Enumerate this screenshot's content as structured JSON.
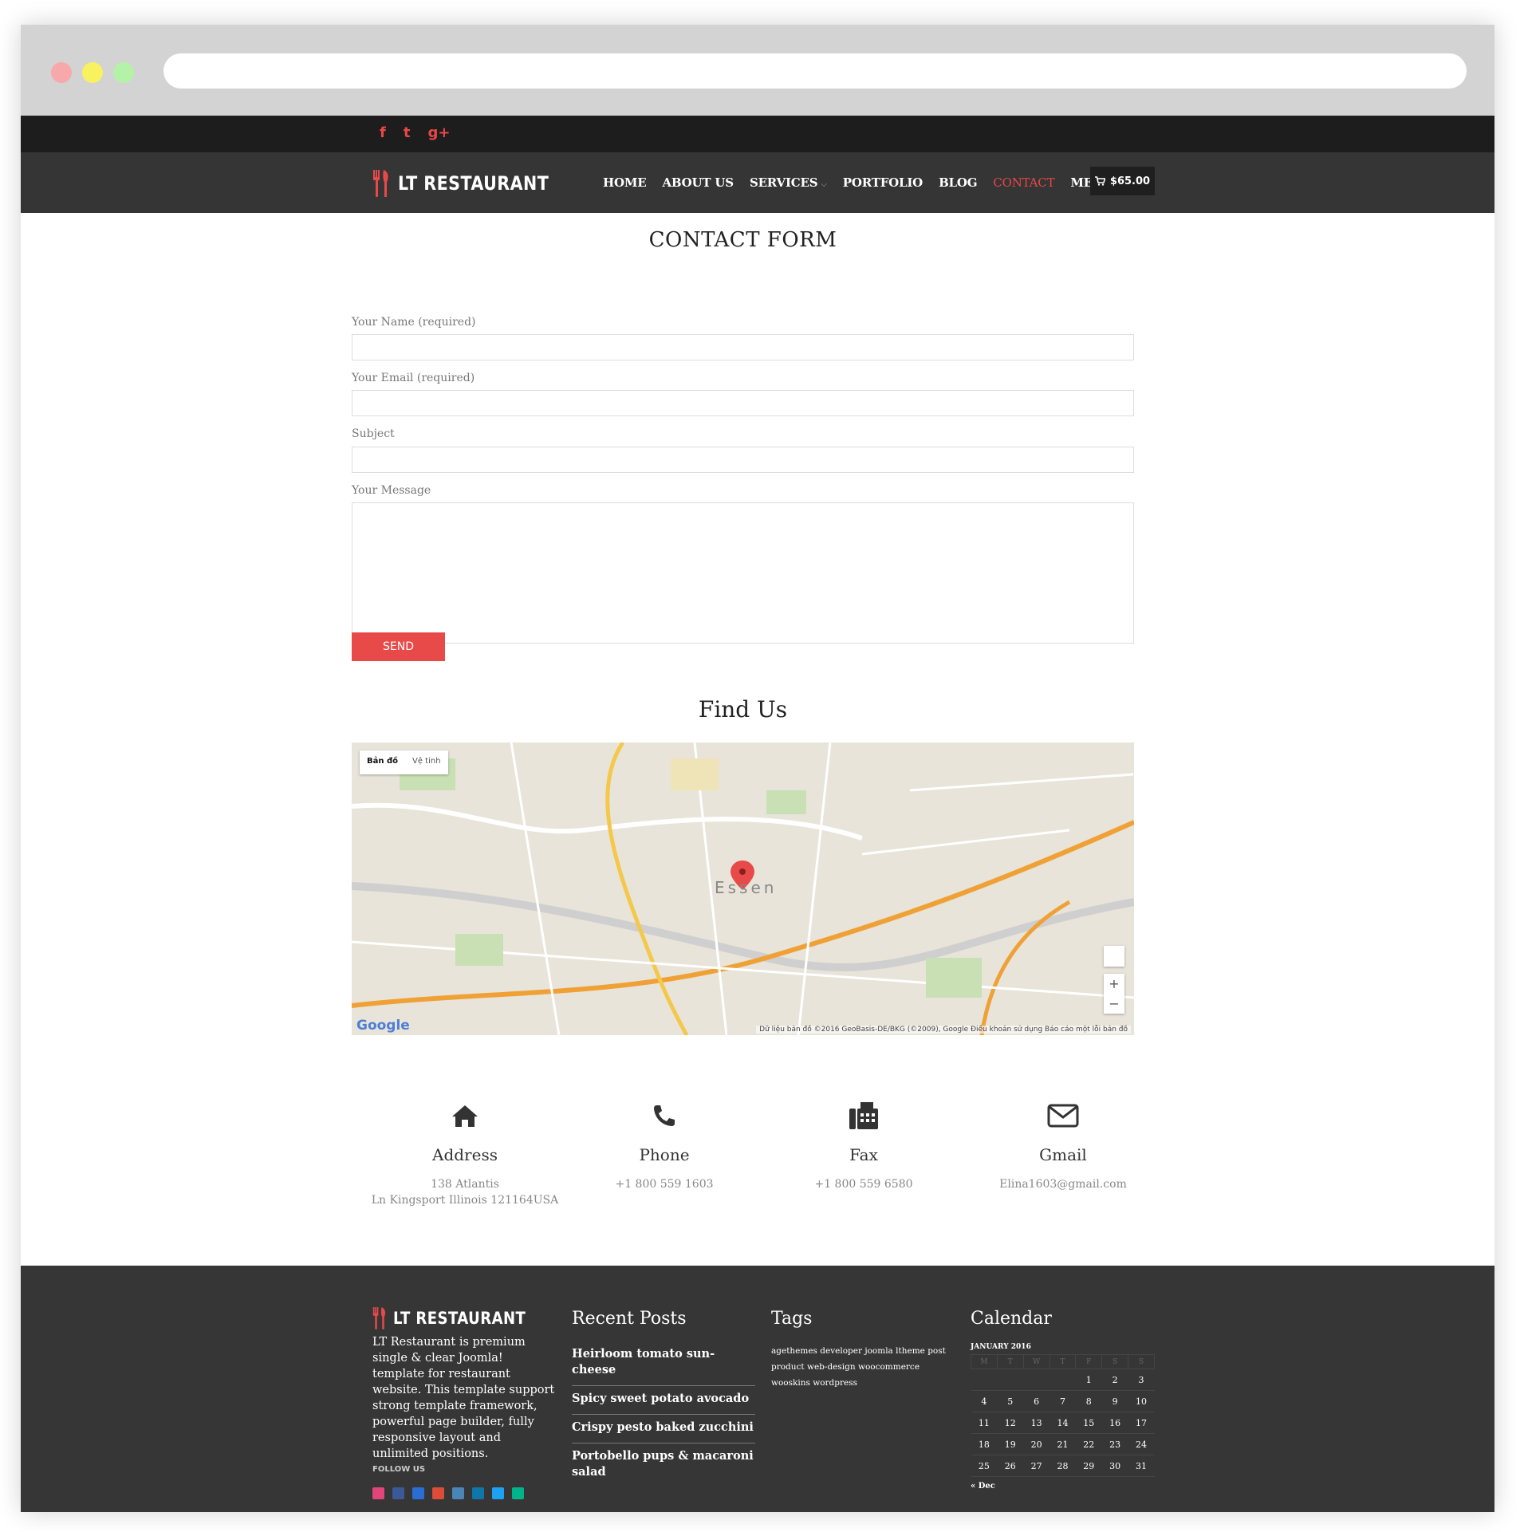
{
  "social_top": [
    "f",
    "t",
    "g+"
  ],
  "brand": {
    "name": "LT RESTAURANT"
  },
  "nav": {
    "items": [
      {
        "label": "HOME",
        "active": false,
        "dropdown": false
      },
      {
        "label": "ABOUT US",
        "active": false,
        "dropdown": false
      },
      {
        "label": "SERVICES",
        "active": false,
        "dropdown": true
      },
      {
        "label": "PORTFOLIO",
        "active": false,
        "dropdown": false
      },
      {
        "label": "BLOG",
        "active": false,
        "dropdown": false
      },
      {
        "label": "CONTACT",
        "active": true,
        "dropdown": false
      },
      {
        "label": "MENU",
        "active": false,
        "dropdown": true
      }
    ],
    "cart_total": "$65.00"
  },
  "form": {
    "title": "CONTACT FORM",
    "name_label": "Your Name (required)",
    "email_label": "Your Email (required)",
    "subject_label": "Subject",
    "message_label": "Your Message",
    "send_label": "SEND"
  },
  "map": {
    "title": "Find Us",
    "type_map": "Bản đồ",
    "type_satellite": "Vệ tinh",
    "city_label": "Essen",
    "attribution": "Dữ liệu bản đồ ©2016 GeoBasis-DE/BKG (©2009), Google   Điều khoản sử dụng   Báo cáo một lỗi bản đồ",
    "google": "Google",
    "zoom_in": "+",
    "zoom_out": "−"
  },
  "contact": [
    {
      "title": "Address",
      "line1": "138 Atlantis",
      "line2": "Ln Kingsport Illinois 121164USA",
      "icon": "home-icon"
    },
    {
      "title": "Phone",
      "line1": "+1 800 559 1603",
      "line2": "",
      "icon": "phone-icon"
    },
    {
      "title": "Fax",
      "line1": "+1 800 559 6580",
      "line2": "",
      "icon": "fax-icon"
    },
    {
      "title": "Gmail",
      "line1": "Elina1603@gmail.com",
      "line2": "",
      "icon": "envelope-icon"
    }
  ],
  "footer": {
    "about": "LT Restaurant is premium single & clear Joomla! template for restaurant website. This template support strong template framework, powerful page builder, fully responsive layout and unlimited positions.",
    "follow": "FOLLOW US",
    "follow_icon_colors": [
      "#e0457b",
      "#3b5998",
      "#2a6dd4",
      "#dd4b39",
      "#4a86b5",
      "#0e76a8",
      "#1da1f2",
      "#00b489"
    ],
    "recent_title": "Recent Posts",
    "recent": [
      "Heirloom tomato sun-cheese",
      "Spicy sweet potato avocado",
      "Crispy pesto baked zucchini",
      "Portobello pups & macaroni salad"
    ],
    "tags_title": "Tags",
    "tags": "agethemes developer joomla ltheme post product web-design woocommerce wooskins wordpress",
    "calendar_title": "Calendar",
    "calendar_caption": "JANUARY 2016",
    "calendar_days": [
      "M",
      "T",
      "W",
      "T",
      "F",
      "S",
      "S"
    ],
    "calendar_rows": [
      [
        "",
        "",
        "",
        "",
        "1",
        "2",
        "3"
      ],
      [
        "4",
        "5",
        "6",
        "7",
        "8",
        "9",
        "10"
      ],
      [
        "11",
        "12",
        "13",
        "14",
        "15",
        "16",
        "17"
      ],
      [
        "18",
        "19",
        "20",
        "21",
        "22",
        "23",
        "24"
      ],
      [
        "25",
        "26",
        "27",
        "28",
        "29",
        "30",
        "31"
      ]
    ],
    "calendar_prev": "« Dec"
  },
  "colors": {
    "accent": "#e84a4a",
    "nav_bg": "#353535",
    "topbar_bg": "#1d1d1d",
    "footer_bg": "#363636"
  }
}
